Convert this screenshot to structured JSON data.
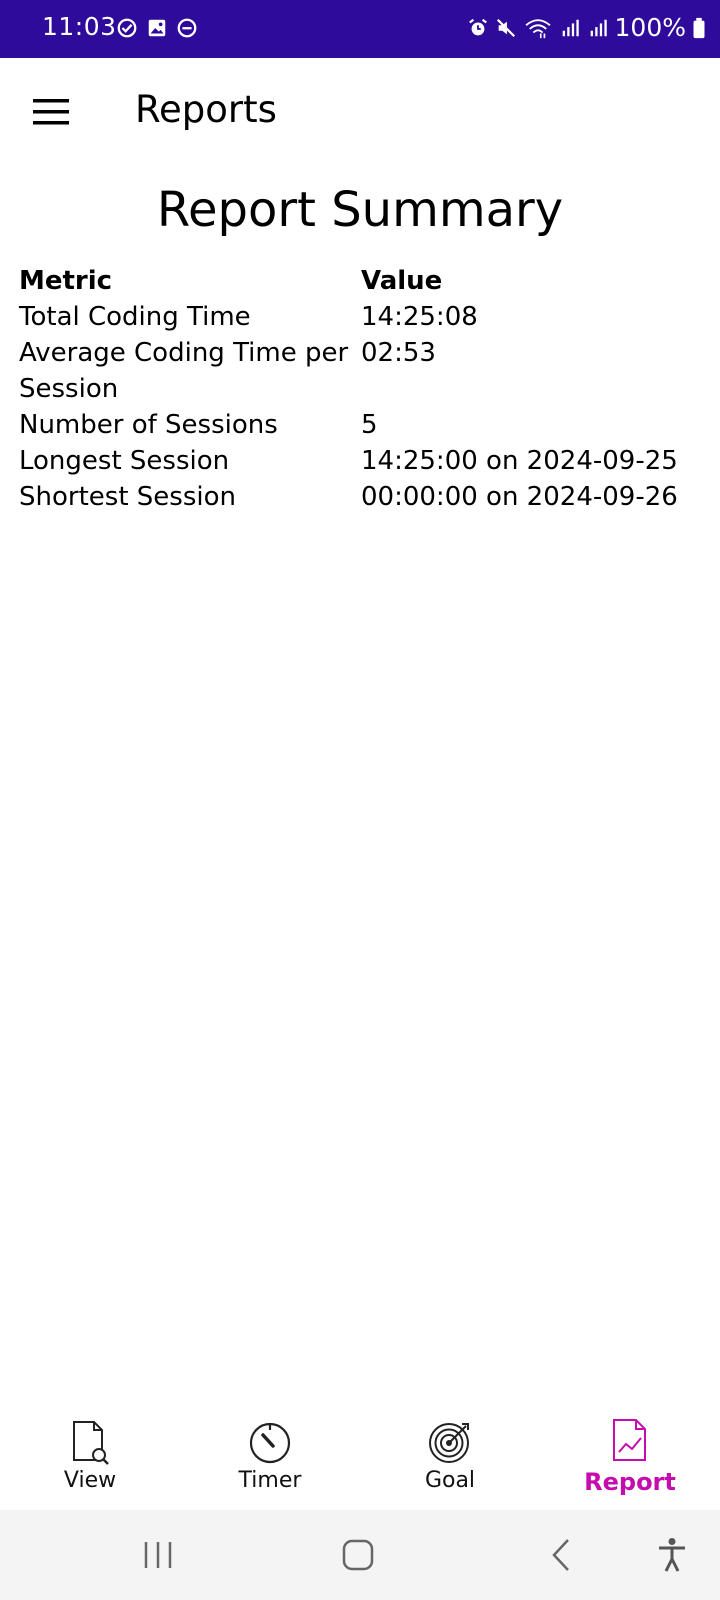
{
  "status_bar": {
    "time": "11:03",
    "battery": "100%",
    "left_icons": [
      "check-circle-icon",
      "image-icon",
      "do-not-disturb-icon"
    ],
    "right_icons": [
      "alarm-icon",
      "mute-icon",
      "wifi-icon",
      "signal-icon",
      "signal-icon",
      "battery-icon"
    ]
  },
  "app_bar": {
    "title": "Reports",
    "menu_icon": "hamburger-menu-icon"
  },
  "report": {
    "title": "Report Summary",
    "headers": {
      "metric": "Metric",
      "value": "Value"
    },
    "rows": [
      {
        "metric": "Total Coding Time",
        "value": "14:25:08"
      },
      {
        "metric": "Average Coding Time per Session",
        "value": "02:53"
      },
      {
        "metric": "Number of Sessions",
        "value": "5"
      },
      {
        "metric": "Longest Session",
        "value": "14:25:00 on 2024-09-25"
      },
      {
        "metric": "Shortest Session",
        "value": "00:00:00 on 2024-09-26"
      }
    ]
  },
  "bottom_nav": {
    "items": [
      {
        "label": "View",
        "icon": "document-search-icon",
        "active": false
      },
      {
        "label": "Timer",
        "icon": "timer-dial-icon",
        "active": false
      },
      {
        "label": "Goal",
        "icon": "target-icon",
        "active": false
      },
      {
        "label": "Report",
        "icon": "report-chart-icon",
        "active": true
      }
    ]
  },
  "colors": {
    "status_bar_bg": "#2e0b9b",
    "accent": "#c50cae",
    "system_nav_bg": "#f4f4f4"
  }
}
